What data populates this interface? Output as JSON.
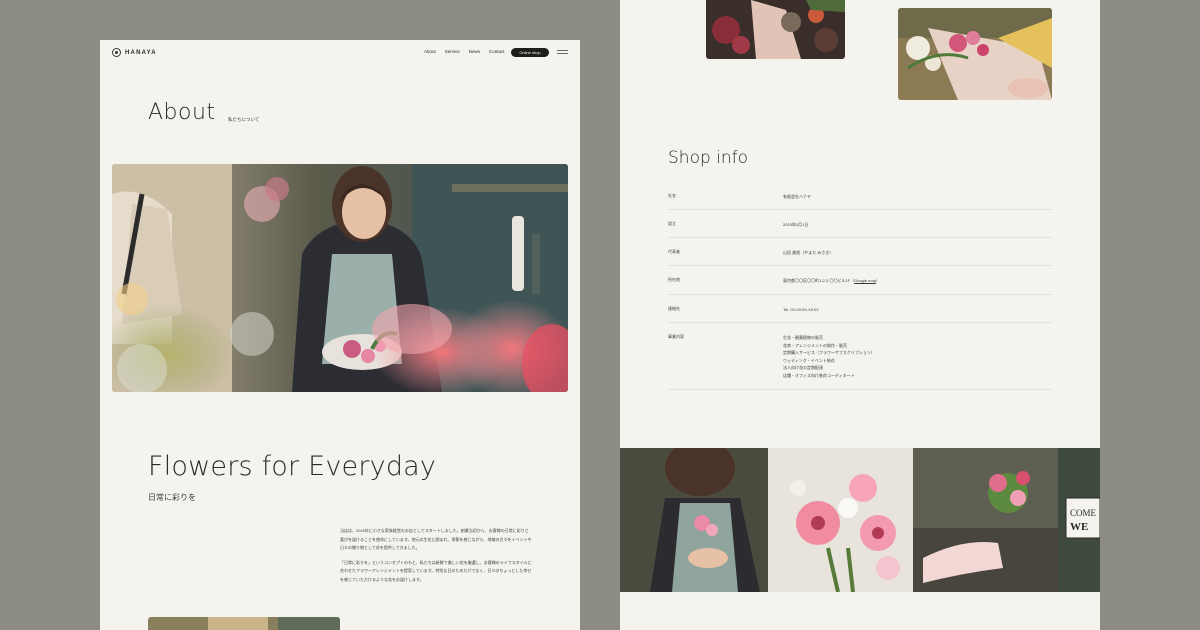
{
  "nav": {
    "logo": "HANAYA",
    "links": [
      "About",
      "Service",
      "News",
      "Contact"
    ],
    "cta": "Online shop"
  },
  "about": {
    "title": "About",
    "subtitle": "私たちについて"
  },
  "intro": {
    "title": "Flowers for Everyday",
    "subtitle": "日常に彩りを",
    "paragraphs": [
      "当店は、2015年に小さな家族経営のお店としてスタートしました。創業当初から、お客様の日常に彩りと喜びを届けることを使命にしています。地元の生花に囲まれ、季節を感じながら、地域の方々をイベントや日々の贈り物として花を提供してきました。",
      "「日常に彩りを」というコンセプトのもと、私たちは新鮮で美しい花を厳選し、お客様のライフスタイルに合わせたフラワーアレンジメントを提案しています。特別な日のためだけでなく、日々のちょっとした幸せを感じていただけるような花をお届けします。"
    ]
  },
  "shop": {
    "title": "Shop info",
    "rows": [
      {
        "label": "社名",
        "value": "有限会社ハナヤ"
      },
      {
        "label": "設立",
        "value": "2015年5月1日"
      },
      {
        "label": "代表者",
        "value": "山田 美咲（やまだ みさき）"
      },
      {
        "label": "所在地",
        "value": "東京都〇〇区〇〇町1-2-3 〇〇ビル1F",
        "link": "Google map"
      },
      {
        "label": "連絡先",
        "value": "Tel. 03-XXXX-XXXX"
      },
      {
        "label": "事業内容",
        "value_lines": [
          "生花・観葉植物の販売",
          "花束・アレンジメントの制作・販売",
          "定期購入サービス（フラワーサブスクリプション）",
          "ウェディング・イベント装花",
          "法人向け花の定期配達",
          "店舗・オフィス向け装花コーディネート"
        ]
      }
    ]
  },
  "colors": {
    "background": "#8d8c82",
    "panel": "#f4f3ee",
    "text": "#2a2a26",
    "button": "#1e1e1b"
  }
}
